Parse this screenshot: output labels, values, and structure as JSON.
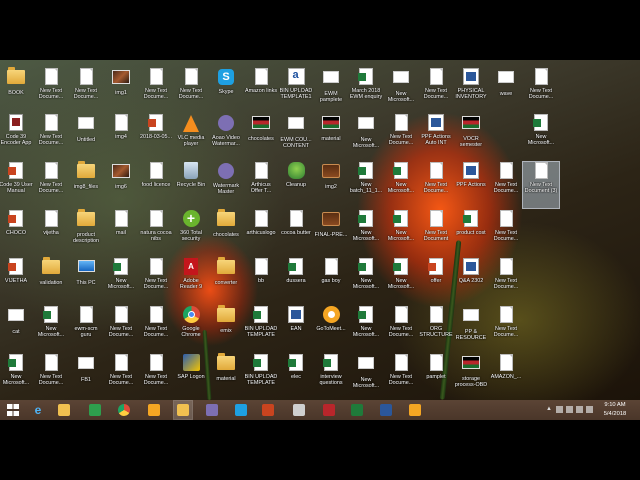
{
  "desktop": {
    "icons": [
      {
        "label": "BOOK",
        "icon": "folder-icon"
      },
      {
        "label": "New Text\nDocume...",
        "icon": "text-document-icon"
      },
      {
        "label": "New Text\nDocume...",
        "icon": "text-document-icon"
      },
      {
        "label": "img1",
        "icon": "image-file-icon"
      },
      {
        "label": "New Text\nDocume...",
        "icon": "text-document-icon"
      },
      {
        "label": "New Text\nDocume...",
        "icon": "text-document-icon"
      },
      {
        "label": "Skype",
        "icon": "skype-icon"
      },
      {
        "label": "Amazon links",
        "icon": "text-document-icon"
      },
      {
        "label": "BIN UPLOAD\nTEMPLATE1",
        "icon": "wordpad-document-icon"
      },
      {
        "label": "EWM\npamplete",
        "icon": "document-image-icon"
      },
      {
        "label": "March 2018\nEWM enquiry",
        "icon": "excel-file-icon"
      },
      {
        "label": "New\nMicrosoft...",
        "icon": "blank-file-icon"
      },
      {
        "label": "New Text\nDocume...",
        "icon": "text-document-icon"
      },
      {
        "label": "PHYSICAL\nINVENTORY",
        "icon": "word-file-icon"
      },
      {
        "label": "wave",
        "icon": "document-image-icon"
      },
      {
        "label": "New Text\nDocume...",
        "icon": "text-document-icon"
      },
      {
        "label": "Code 39\nEncoder App",
        "icon": "barcode-app-icon"
      },
      {
        "label": "New Text\nDocume...",
        "icon": "text-document-icon"
      },
      {
        "label": "Untitled",
        "icon": "blank-file-icon"
      },
      {
        "label": "img4",
        "icon": "text-document-icon"
      },
      {
        "label": "2018-03-05...",
        "icon": "powerpoint-file-icon"
      },
      {
        "label": "VLC media\nplayer",
        "icon": "vlc-icon"
      },
      {
        "label": "Aoao Video\nWatermar...",
        "icon": "watermark-app-icon"
      },
      {
        "label": "chocolates",
        "icon": "flag-image-icon"
      },
      {
        "label": "EWM COU...\nCONTENT",
        "icon": "document-image-icon"
      },
      {
        "label": "material",
        "icon": "flag-image-icon"
      },
      {
        "label": "New\nMicrosoft...",
        "icon": "blank-file-icon"
      },
      {
        "label": "New Text\nDocume...",
        "icon": "text-document-icon"
      },
      {
        "label": "PPF Actions\nAuto INT",
        "icon": "word-file-icon"
      },
      {
        "label": "VOCR\nsemester",
        "icon": "flag-image-icon"
      },
      {
        "label": "New\nMicrosoft...",
        "icon": "excel-file-icon"
      },
      {
        "label": "Code 39 User\nManual",
        "icon": "powerpoint-file-icon"
      },
      {
        "label": "New Text\nDocume...",
        "icon": "text-document-icon"
      },
      {
        "label": "img8_files",
        "icon": "folder-icon"
      },
      {
        "label": "img6",
        "icon": "image-file-icon"
      },
      {
        "label": "food licence",
        "icon": "text-document-icon"
      },
      {
        "label": "Recycle Bin",
        "icon": "recycle-bin-icon"
      },
      {
        "label": "Watermark\nMaster",
        "icon": "watermark-app-icon"
      },
      {
        "label": "Arthicus\nOffer T...",
        "icon": "text-document-icon"
      },
      {
        "label": "Cleanup",
        "icon": "cleanup-app-icon"
      },
      {
        "label": "img2",
        "icon": "chocolate-image-icon"
      },
      {
        "label": "New\nbatch_11_1...",
        "icon": "excel-file-icon"
      },
      {
        "label": "New\nMicrosoft...",
        "icon": "excel-file-icon"
      },
      {
        "label": "New Text\nDocume...",
        "icon": "text-document-icon"
      },
      {
        "label": "PPF Actions",
        "icon": "word-file-icon"
      },
      {
        "label": "New Text\nDocume...",
        "icon": "text-document-icon"
      },
      {
        "label": "New Text\nDocument (3)",
        "icon": "text-document-icon"
      },
      {
        "label": "CHOCO",
        "icon": "powerpoint-file-icon"
      },
      {
        "label": "vijetha",
        "icon": "text-document-icon"
      },
      {
        "label": "product\ndescription",
        "icon": "folder-icon"
      },
      {
        "label": "mail",
        "icon": "text-document-icon"
      },
      {
        "label": "natura cocoa\nnibs",
        "icon": "text-document-icon"
      },
      {
        "label": "360 Total\nsecurity",
        "icon": "plus-security-icon"
      },
      {
        "label": "chocolates",
        "icon": "folder-icon"
      },
      {
        "label": "arthicuslogo",
        "icon": "text-document-icon"
      },
      {
        "label": "cocoa butter",
        "icon": "text-document-icon"
      },
      {
        "label": "FINAL-PRE...",
        "icon": "chocolate-image-icon"
      },
      {
        "label": "New\nMicrosoft...",
        "icon": "excel-file-icon"
      },
      {
        "label": "New\nMicrosoft...",
        "icon": "excel-file-icon"
      },
      {
        "label": "New Text\nDocument",
        "icon": "text-document-icon"
      },
      {
        "label": "product cost",
        "icon": "excel-file-icon"
      },
      {
        "label": "New Text\nDocume...",
        "icon": "text-document-icon"
      },
      {
        "label": "VIJETHA",
        "icon": "powerpoint-file-icon"
      },
      {
        "label": "validation",
        "icon": "folder-icon"
      },
      {
        "label": "This PC",
        "icon": "this-pc-icon"
      },
      {
        "label": "New\nMicrosoft...",
        "icon": "excel-file-icon"
      },
      {
        "label": "New Text\nDocume...",
        "icon": "text-document-icon"
      },
      {
        "label": "Adobe\nReader 9",
        "icon": "pdf-icon"
      },
      {
        "label": "converter",
        "icon": "folder-icon"
      },
      {
        "label": "bb",
        "icon": "text-document-icon"
      },
      {
        "label": "dussera",
        "icon": "excel-file-icon"
      },
      {
        "label": "gas boy",
        "icon": "text-document-icon"
      },
      {
        "label": "New\nMicrosoft...",
        "icon": "excel-file-icon"
      },
      {
        "label": "New\nMicrosoft...",
        "icon": "excel-file-icon"
      },
      {
        "label": "offer",
        "icon": "powerpoint-file-icon"
      },
      {
        "label": "Q&A 2302",
        "icon": "word-file-icon"
      },
      {
        "label": "New Text\nDocume...",
        "icon": "text-document-icon"
      },
      {
        "label": "cat",
        "icon": "blank-file-icon"
      },
      {
        "label": "New\nMicrosoft...",
        "icon": "excel-file-icon"
      },
      {
        "label": "ewm-scm\nguru",
        "icon": "text-document-icon"
      },
      {
        "label": "New Text\nDocume...",
        "icon": "text-document-icon"
      },
      {
        "label": "New Text\nDocume...",
        "icon": "text-document-icon"
      },
      {
        "label": "Google\nChrome",
        "icon": "chrome-icon"
      },
      {
        "label": "emix",
        "icon": "folder-icon"
      },
      {
        "label": "BIN UPLOAD\nTEMPLATE",
        "icon": "excel-file-icon"
      },
      {
        "label": "EAN",
        "icon": "ean-document-icon"
      },
      {
        "label": "GoToMeet...",
        "icon": "gotomeeting-icon"
      },
      {
        "label": "New\nMicrosoft...",
        "icon": "excel-file-icon"
      },
      {
        "label": "New Text\nDocume...",
        "icon": "text-document-icon"
      },
      {
        "label": "ORG\nSTRUCTURE",
        "icon": "text-document-icon"
      },
      {
        "label": "PP &\nRESOURCE",
        "icon": "document-image-icon"
      },
      {
        "label": "New Text\nDocume...",
        "icon": "text-document-icon"
      },
      {
        "label": "New\nMicrosoft...",
        "icon": "excel-file-icon"
      },
      {
        "label": "New Text\nDocume...",
        "icon": "text-document-icon"
      },
      {
        "label": "FB1",
        "icon": "blank-file-icon"
      },
      {
        "label": "New Text\nDocume...",
        "icon": "text-document-icon"
      },
      {
        "label": "New Text\nDocume...",
        "icon": "text-document-icon"
      },
      {
        "label": "SAP Logon",
        "icon": "sap-logon-icon"
      },
      {
        "label": "material",
        "icon": "folder-icon"
      },
      {
        "label": "BIN UPLOAD\nTEMPLATE",
        "icon": "excel-file-icon"
      },
      {
        "label": "elec",
        "icon": "excel-file-icon"
      },
      {
        "label": "interview\nquestions",
        "icon": "excel-file-icon"
      },
      {
        "label": "New\nMicrosoft...",
        "icon": "blank-file-icon"
      },
      {
        "label": "New Text\nDocume...",
        "icon": "text-document-icon"
      },
      {
        "label": "pamplet",
        "icon": "text-document-icon"
      },
      {
        "label": "storage\nprocess-OBD",
        "icon": "flag-image-icon"
      },
      {
        "label": "AMAZON_...",
        "icon": "text-document-icon"
      }
    ]
  },
  "taskbar": {
    "apps": [
      {
        "name": "start-button",
        "icon": "windows-logo-icon"
      },
      {
        "name": "taskbar-internet-explorer",
        "icon": "internet-explorer-icon"
      },
      {
        "name": "taskbar-file-explorer",
        "icon": "file-explorer-icon"
      },
      {
        "name": "taskbar-store",
        "icon": "store-icon"
      },
      {
        "name": "taskbar-chrome",
        "icon": "chrome-icon"
      },
      {
        "name": "taskbar-gotomeeting",
        "icon": "gotomeeting-icon"
      },
      {
        "name": "taskbar-explorer-window",
        "icon": "file-explorer-icon"
      },
      {
        "name": "taskbar-watermark",
        "icon": "watermark-app-icon"
      },
      {
        "name": "taskbar-skype",
        "icon": "skype-icon"
      },
      {
        "name": "taskbar-powerpoint",
        "icon": "powerpoint-file-icon"
      },
      {
        "name": "taskbar-document",
        "icon": "text-document-icon"
      },
      {
        "name": "taskbar-flag-image",
        "icon": "flag-image-icon"
      },
      {
        "name": "taskbar-excel",
        "icon": "excel-file-icon"
      },
      {
        "name": "taskbar-word",
        "icon": "word-file-icon"
      },
      {
        "name": "taskbar-gotomeeting-2",
        "icon": "gotomeeting-icon"
      }
    ],
    "clock": {
      "time": "9:10 AM",
      "date": "5/4/2018"
    }
  },
  "colors": {
    "taskbar": "#4a3629",
    "label_text": "#ffffff",
    "selection": "#c8dcf0"
  }
}
